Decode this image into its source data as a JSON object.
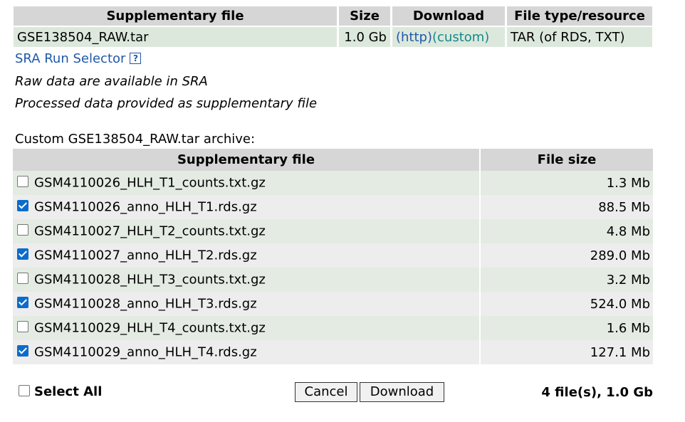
{
  "top_table": {
    "headers": [
      "Supplementary file",
      "Size",
      "Download",
      "File type/resource"
    ],
    "row": {
      "file": "GSE138504_RAW.tar",
      "size": "1.0 Gb",
      "http_link": "(http)",
      "custom_link": "(custom)",
      "type": "TAR (of RDS, TXT)"
    }
  },
  "sra": {
    "link_label": "SRA Run Selector",
    "help_glyph": "?"
  },
  "notes": {
    "raw": "Raw data are available in SRA",
    "processed": "Processed data provided as supplementary file"
  },
  "archive": {
    "label": "Custom GSE138504_RAW.tar archive:",
    "headers": [
      "Supplementary file",
      "File size"
    ],
    "rows": [
      {
        "name": "GSM4110026_HLH_T1_counts.txt.gz",
        "size": "1.3 Mb",
        "checked": false
      },
      {
        "name": "GSM4110026_anno_HLH_T1.rds.gz",
        "size": "88.5 Mb",
        "checked": true
      },
      {
        "name": "GSM4110027_HLH_T2_counts.txt.gz",
        "size": "4.8 Mb",
        "checked": false
      },
      {
        "name": "GSM4110027_anno_HLH_T2.rds.gz",
        "size": "289.0 Mb",
        "checked": true
      },
      {
        "name": "GSM4110028_HLH_T3_counts.txt.gz",
        "size": "3.2 Mb",
        "checked": false
      },
      {
        "name": "GSM4110028_anno_HLH_T3.rds.gz",
        "size": "524.0 Mb",
        "checked": true
      },
      {
        "name": "GSM4110029_HLH_T4_counts.txt.gz",
        "size": "1.6 Mb",
        "checked": false
      },
      {
        "name": "GSM4110029_anno_HLH_T4.rds.gz",
        "size": "127.1 Mb",
        "checked": true
      }
    ]
  },
  "footer": {
    "select_all_label": "Select All",
    "select_all_checked": false,
    "cancel_label": "Cancel",
    "download_label": "Download",
    "summary": "4 file(s), 1.0 Gb"
  },
  "colors": {
    "link_blue": "#1f58a8",
    "link_teal": "#128a8a",
    "header_gray": "#d6d6d6",
    "row_green": "#e3ebe3",
    "row_gray": "#ededed",
    "checkbox_blue": "#0b6ccb"
  }
}
